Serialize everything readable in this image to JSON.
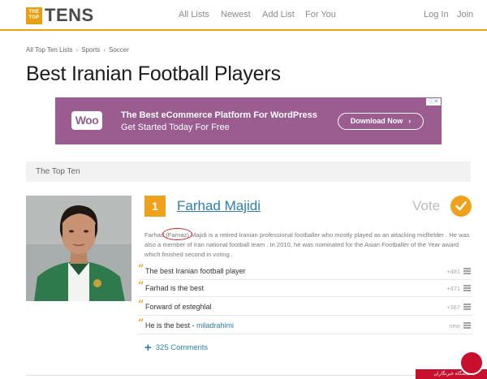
{
  "header": {
    "logo_small": "THE TOP",
    "logo_word": "TENS",
    "nav": [
      "All Lists",
      "Newest",
      "Add List",
      "For You"
    ],
    "login": "Log In",
    "join": "Join",
    "accent": "#f0a11c"
  },
  "breadcrumb": [
    "All Top Ten Lists",
    "Sports",
    "Soccer"
  ],
  "page": {
    "title": "Best Iranian Football Players"
  },
  "ad": {
    "logo": "Woo",
    "headline": "The Best eCommerce Platform For WordPress",
    "sub": "Get Started Today For Free",
    "button": "Download Now",
    "color": "#9b5c8f"
  },
  "section": {
    "label": "The Top Ten"
  },
  "item": {
    "rank": "1",
    "name": "Farhad Majidi",
    "vote_label": "Vote",
    "desc_1": "Farhad",
    "desc_highlight": "(Farnaz)",
    "desc_2": "Majidi is a retired Iranian professional footballer who mostly played as an attacking midfielder . He was also a member of Iran national football team . In 2010, he was nominated for the Asian Footballer of the Year award which finished second in voting .",
    "comments": [
      {
        "text": "The best Iranian football player",
        "author": "",
        "score": "+481"
      },
      {
        "text": "Farhad is the best",
        "author": "",
        "score": "+471"
      },
      {
        "text": "Forward of esteghlal",
        "author": "",
        "score": "+387"
      },
      {
        "text": "He is the best - ",
        "author": "miladrahimi",
        "score": "new"
      }
    ],
    "more_comments": "325 Comments"
  },
  "watermark": {
    "text": "باشگاه خبرنگاران"
  }
}
